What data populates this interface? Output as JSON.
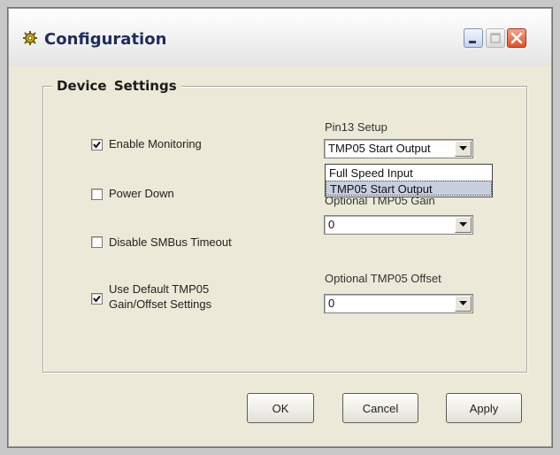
{
  "window": {
    "title": "Configuration",
    "controls": {
      "minimize_icon": "minimize-icon",
      "maximize_icon": "maximize-icon",
      "close_icon": "close-icon"
    }
  },
  "group": {
    "legend": "Device  Settings",
    "checkboxes": [
      {
        "label": "Enable Monitoring",
        "checked": true
      },
      {
        "label": "Power Down",
        "checked": false
      },
      {
        "label": "Disable SMBus Timeout",
        "checked": false
      },
      {
        "label_line1": "Use Default TMP05",
        "label_line2": "Gain/Offset Settings",
        "checked": true
      }
    ],
    "pin13": {
      "label": "Pin13 Setup",
      "value": "TMP05 Start Output",
      "options": [
        "Full Speed Input",
        "TMP05 Start Output"
      ],
      "selected_option": "TMP05 Start Output"
    },
    "gain": {
      "label": "Optional TMP05 Gain",
      "value": "0"
    },
    "offset": {
      "label": "Optional  TMP05 Offset",
      "value": "0"
    }
  },
  "buttons": {
    "ok": "OK",
    "cancel": "Cancel",
    "apply": "Apply"
  },
  "colors": {
    "title_text": "#1f2d5c",
    "window_bg": "#ece9d8",
    "close_button": "#d9532d",
    "selection": "#c8cfe0"
  }
}
